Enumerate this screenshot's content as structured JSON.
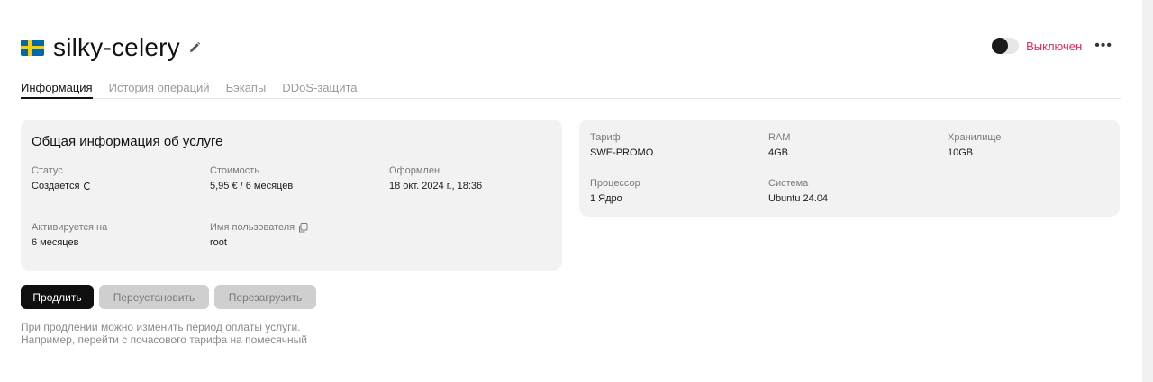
{
  "header": {
    "server_name": "silky-celery"
  },
  "power": {
    "label": "Выключен",
    "state": "off",
    "label_color": "#e5295a"
  },
  "tabs": [
    {
      "label": "Информация",
      "active": true
    },
    {
      "label": "История операций",
      "active": false
    },
    {
      "label": "Бэкапы",
      "active": false
    },
    {
      "label": "DDoS-защита",
      "active": false
    }
  ],
  "general": {
    "title": "Общая информация об услуге",
    "status_label": "Статус",
    "status_value": "Создается",
    "cost_label": "Стоимость",
    "cost_value": "5,95 € / 6 месяцев",
    "created_label": "Оформлен",
    "created_value": "18 окт. 2024 г., 18:36",
    "activated_label": "Активируется на",
    "activated_value": "6 месяцев",
    "username_label": "Имя пользователя",
    "username_value": "root"
  },
  "specs": {
    "tariff_label": "Тариф",
    "tariff_value": "SWE-PROMO",
    "ram_label": "RAM",
    "ram_value": "4GB",
    "storage_label": "Хранилище",
    "storage_value": "10GB",
    "cpu_label": "Процессор",
    "cpu_value": "1 Ядро",
    "os_label": "Система",
    "os_value": "Ubuntu 24.04"
  },
  "actions": {
    "renew": "Продлить",
    "reinstall": "Переустановить",
    "reboot": "Перезагрузить"
  },
  "hint": {
    "line1": "При продлении можно изменить период оплаты услуги.",
    "line2": "Например, перейти с почасового тарифа на помесячный"
  }
}
